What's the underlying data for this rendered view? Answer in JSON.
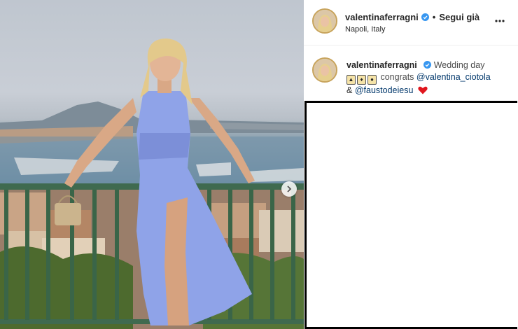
{
  "post": {
    "username": "valentinaferragni",
    "follow_label": "Segui già",
    "separator": "•",
    "location": "Napoli, Italy",
    "verified": true
  },
  "caption": {
    "username": "valentinaferragni",
    "text_1": "Wedding day",
    "text_2": "congrats",
    "mention_1": "@valentina_ciotola",
    "text_3": "&",
    "mention_2": "@faustodeiesu",
    "emojis": [
      "cake-emoji",
      "trophy-emoji",
      "person-emoji"
    ]
  },
  "icons": {
    "verified": "verified-badge-icon",
    "more": "more-options-icon",
    "next": "chevron-right-icon",
    "heart": "red-heart-icon"
  },
  "colors": {
    "verified_blue": "#3897f0",
    "mention_blue": "#00376b",
    "heart_red": "#e0161e",
    "dress_blue": "#8fa3e8"
  }
}
